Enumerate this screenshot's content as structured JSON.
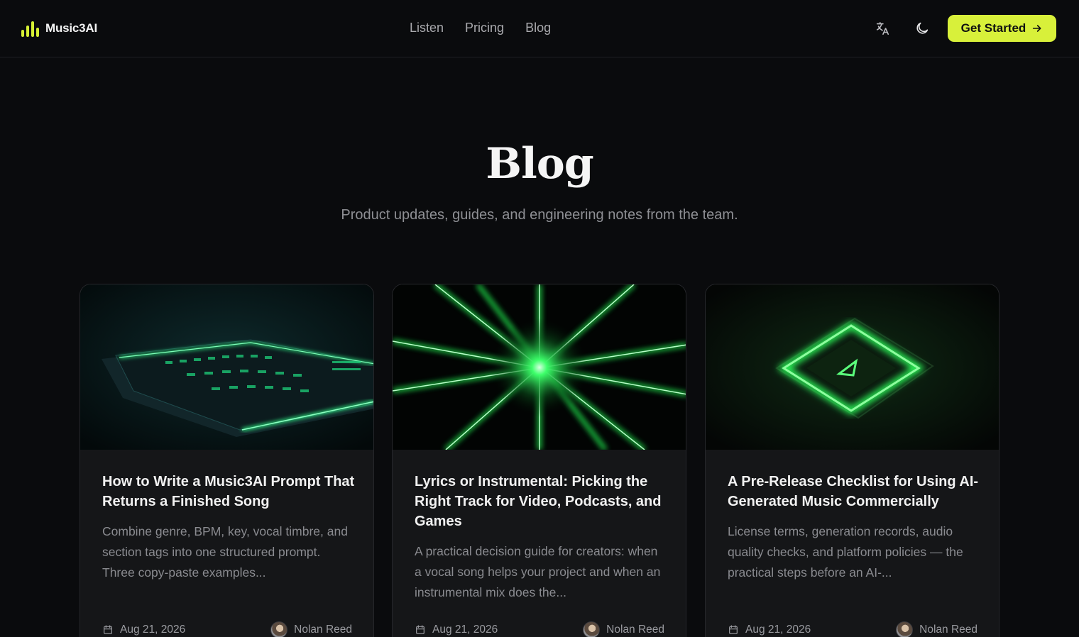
{
  "brand": {
    "name": "Music3AI",
    "accent": "#d8f03a"
  },
  "nav": {
    "items": [
      "Listen",
      "Pricing",
      "Blog"
    ]
  },
  "header": {
    "translate_icon": "translate-icon",
    "theme_icon": "moon-icon",
    "cta_label": "Get Started",
    "cta_icon": "arrow-right-icon"
  },
  "hero": {
    "title": "Blog",
    "subtitle": "Product updates, guides, and engineering notes from the team."
  },
  "posts": [
    {
      "title": "How to Write a Music3AI Prompt That Returns a Finished Song",
      "excerpt": "Combine genre, BPM, key, vocal timbre, and section tags into one structured prompt. Three copy-paste examples...",
      "date": "Aug 21, 2026",
      "author": "Nolan Reed",
      "image": "glowing-keyboard"
    },
    {
      "title": "Lyrics or Instrumental: Picking the Right Track for Video, Podcasts, and Games",
      "excerpt": "A practical decision guide for creators: when a vocal song helps your project and when an instrumental mix does the...",
      "date": "Aug 21, 2026",
      "author": "Nolan Reed",
      "image": "green-starburst"
    },
    {
      "title": "A Pre-Release Checklist for Using AI-Generated Music Commercially",
      "excerpt": "License terms, generation records, audio quality checks, and platform policies — the practical steps before an AI-...",
      "date": "Aug 21, 2026",
      "author": "Nolan Reed",
      "image": "glowing-play-tile"
    }
  ]
}
